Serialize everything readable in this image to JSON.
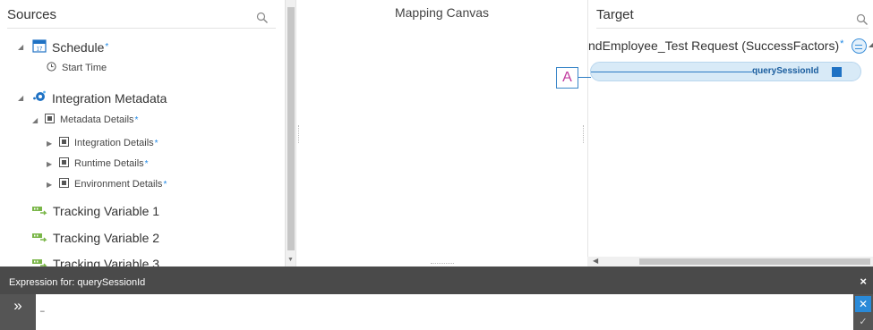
{
  "sources": {
    "title": "Sources",
    "tree": [
      {
        "label": "Schedule",
        "required": "*",
        "level": 1,
        "icon": "calendar-icon"
      },
      {
        "label": "Start Time",
        "level": 2,
        "icon": "clock-icon"
      },
      {
        "label": "Integration Metadata",
        "level": 1,
        "icon": "integration-metadata-icon"
      },
      {
        "label": "Metadata Details",
        "required": "*",
        "level": 2,
        "icon": "element-icon"
      },
      {
        "label": "Integration Details",
        "required": "*",
        "level": 3,
        "icon": "element-icon"
      },
      {
        "label": "Runtime Details",
        "required": "*",
        "level": 3,
        "icon": "element-icon"
      },
      {
        "label": "Environment Details",
        "required": "*",
        "level": 3,
        "icon": "element-icon"
      },
      {
        "label": "Tracking Variable 1",
        "level": 1,
        "icon": "tracking-variable-icon"
      },
      {
        "label": "Tracking Variable 2",
        "level": 1,
        "icon": "tracking-variable-icon"
      },
      {
        "label": "Tracking Variable 3",
        "level": 1,
        "icon": "tracking-variable-icon"
      }
    ]
  },
  "canvas": {
    "title": "Mapping Canvas",
    "marker": "A"
  },
  "target": {
    "title": "Target",
    "root_label": "ndEmployee_Test Request (SuccessFactors)",
    "root_required": "*",
    "mapped_field": "querySessionId"
  },
  "expression": {
    "title": "Expression for: querySessionId",
    "close": "×",
    "toggle": "»",
    "value": "–"
  },
  "colors": {
    "accent": "#1f72c4",
    "expression_bar": "#4a4a4a",
    "mapped_row": "#d8eaf7",
    "marker_text": "#c0399e",
    "tracking_icon": "#7ab648"
  }
}
